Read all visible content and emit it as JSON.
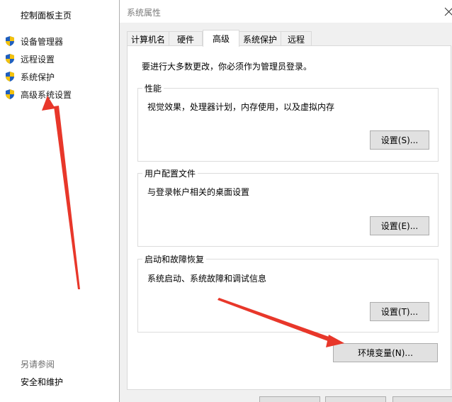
{
  "left_pane": {
    "home": "控制面板主页",
    "items": [
      {
        "label": "设备管理器",
        "icon": "shield-icon"
      },
      {
        "label": "远程设置",
        "icon": "shield-icon"
      },
      {
        "label": "系统保护",
        "icon": "shield-icon"
      },
      {
        "label": "高级系统设置",
        "icon": "shield-icon"
      }
    ],
    "see_also": "另请参阅",
    "security_link": "安全和维护"
  },
  "dialog": {
    "title": "系统属性",
    "tabs": [
      {
        "label": "计算机名",
        "active": false
      },
      {
        "label": "硬件",
        "active": false
      },
      {
        "label": "高级",
        "active": true
      },
      {
        "label": "系统保护",
        "active": false
      },
      {
        "label": "远程",
        "active": false
      }
    ],
    "admin_note": "要进行大多数更改，你必须作为管理员登录。",
    "groups": [
      {
        "title": "性能",
        "desc": "视觉效果，处理器计划，内存使用，以及虚拟内存",
        "button": "设置(S)..."
      },
      {
        "title": "用户配置文件",
        "desc": "与登录帐户相关的桌面设置",
        "button": "设置(E)..."
      },
      {
        "title": "启动和故障恢复",
        "desc": "系统启动、系统故障和调试信息",
        "button": "设置(T)..."
      }
    ],
    "env_button": "环境变量(N)..."
  },
  "colors": {
    "dialog_bg": "#f0f0f0",
    "panel_bg": "#ffffff",
    "button_bg": "#e1e1e1",
    "arrow": "#e8372a"
  }
}
